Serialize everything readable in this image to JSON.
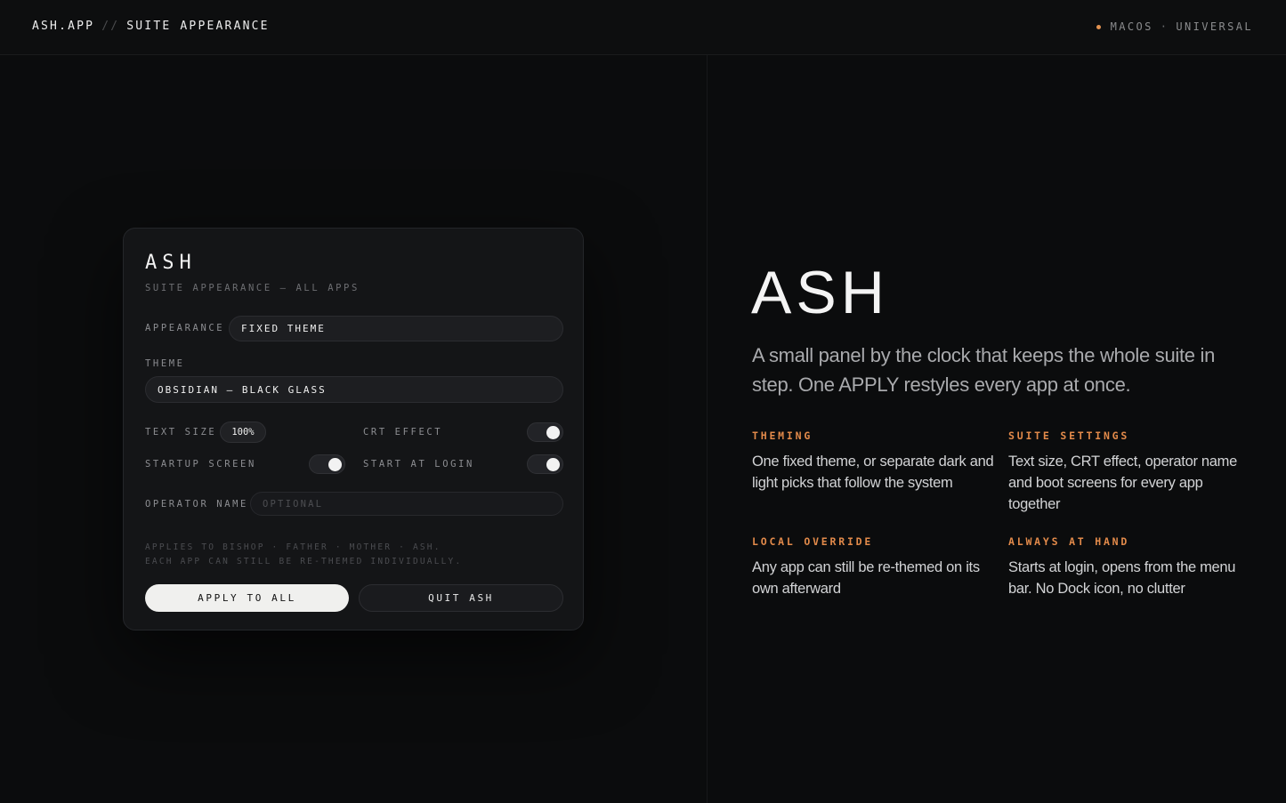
{
  "header": {
    "brand": "ASH.APP",
    "separator": "//",
    "section": "SUITE APPEARANCE",
    "platform": "MACOS",
    "platform_sep": "·",
    "build": "UNIVERSAL",
    "accent": "#e39250"
  },
  "panel": {
    "title": "ASH",
    "subtitle": "SUITE APPEARANCE — ALL APPS",
    "appearance_label": "APPEARANCE",
    "appearance_value": "FIXED THEME",
    "theme_label": "THEME",
    "theme_value": "OBSIDIAN — BLACK GLASS",
    "text_size_label": "TEXT SIZE",
    "text_size_value": "100%",
    "crt_label": "CRT EFFECT",
    "crt_on": true,
    "startup_label": "STARTUP SCREEN",
    "startup_on": true,
    "login_label": "START AT LOGIN",
    "login_on": true,
    "operator_label": "OPERATOR NAME",
    "operator_placeholder": "OPTIONAL",
    "note_line1": "APPLIES TO BISHOP · FATHER · MOTHER · ASH.",
    "note_line2": "EACH APP CAN STILL BE RE-THEMED INDIVIDUALLY.",
    "apply_label": "APPLY TO ALL",
    "quit_label": "QUIT ASH"
  },
  "hero": {
    "title": "ASH",
    "description": "A small panel by the clock that keeps the whole suite in step. One APPLY restyles every app at once."
  },
  "features": [
    {
      "heading": "THEMING",
      "body": "One fixed theme, or separate dark and light picks that follow the system"
    },
    {
      "heading": "SUITE SETTINGS",
      "body": "Text size, CRT effect, operator name and boot screens for every app together"
    },
    {
      "heading": "LOCAL OVERRIDE",
      "body": "Any app can still be re-themed on its own afterward"
    },
    {
      "heading": "ALWAYS AT HAND",
      "body": "Starts at login, opens from the menu bar. No Dock icon, no clutter"
    }
  ]
}
